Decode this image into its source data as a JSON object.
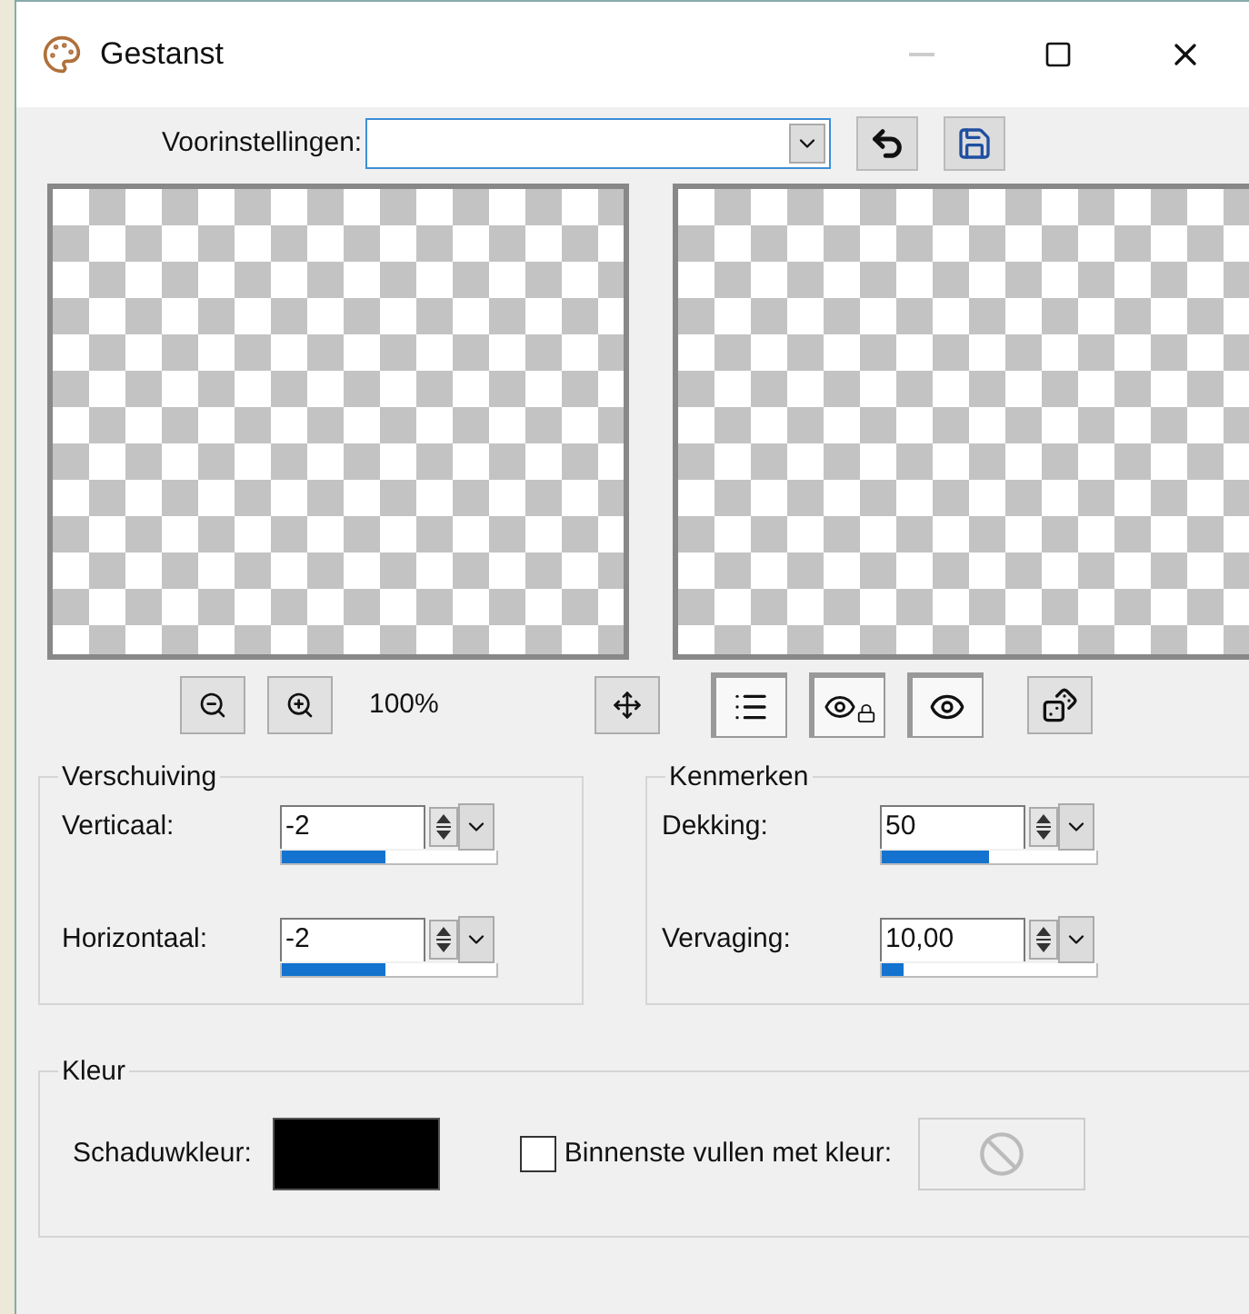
{
  "window": {
    "title": "Gestanst"
  },
  "presets": {
    "label": "Voorinstellingen:"
  },
  "toolbar": {
    "zoom_reading": "100%",
    "toggles": [
      {
        "kind": "list",
        "pressed": true
      },
      {
        "kind": "lock-eye",
        "pressed": true
      },
      {
        "kind": "eye",
        "pressed": true
      }
    ]
  },
  "offset_group": {
    "title": "Verschuiving",
    "fields": [
      {
        "label": "Verticaal:",
        "value": "-2",
        "level": 0.48
      },
      {
        "label": "Horizontaal:",
        "value": "-2",
        "level": 0.48
      }
    ]
  },
  "properties_group": {
    "title": "Kenmerken",
    "fields": [
      {
        "label": "Dekking:",
        "value": "50",
        "level": 0.5
      },
      {
        "label": "Vervaging:",
        "value": "10,00",
        "level": 0.1
      }
    ]
  },
  "color_group": {
    "title": "Kleur",
    "shadow_color": {
      "label": "Schaduwkleur:",
      "color": "#000000"
    },
    "fill_inside": {
      "label": "Binnenste vullen met kleur:",
      "checked": false
    }
  }
}
